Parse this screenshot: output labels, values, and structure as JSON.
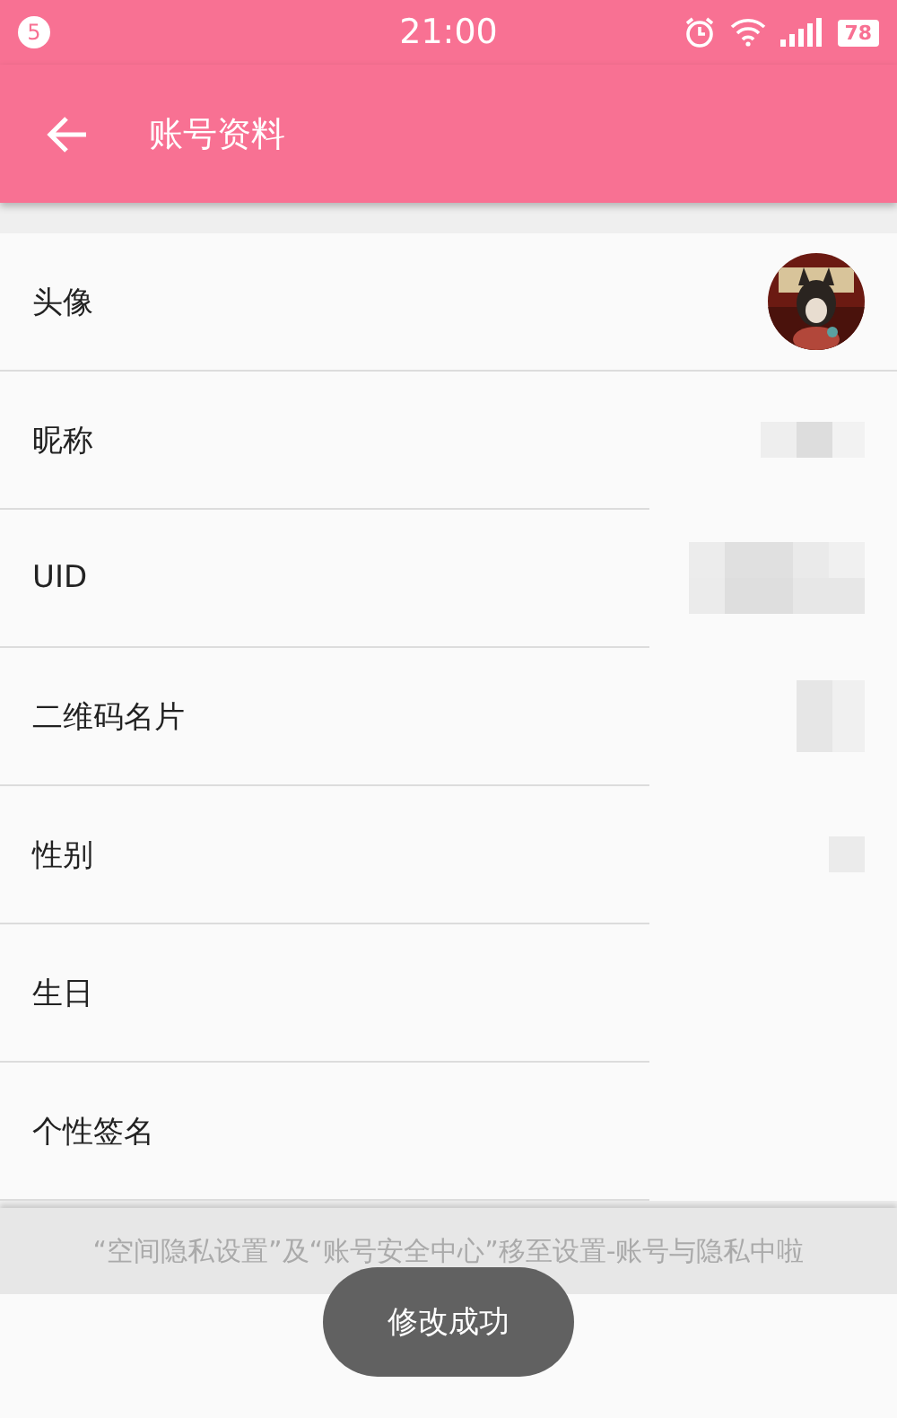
{
  "status_bar": {
    "notification_count": "5",
    "time": "21:00",
    "battery": "78"
  },
  "app_bar": {
    "title": "账号资料"
  },
  "rows": [
    {
      "label": "头像",
      "kind": "avatar"
    },
    {
      "label": "昵称",
      "kind": "redacted"
    },
    {
      "label": "UID",
      "kind": "redacted"
    },
    {
      "label": "二维码名片",
      "kind": "redacted"
    },
    {
      "label": "性别",
      "kind": "redacted"
    },
    {
      "label": "生日",
      "kind": "plain"
    },
    {
      "label": "个性签名",
      "kind": "plain"
    }
  ],
  "notice": "“空间隐私设置”及“账号安全中心”移至设置-账号与隐私中啦",
  "toast": "修改成功"
}
